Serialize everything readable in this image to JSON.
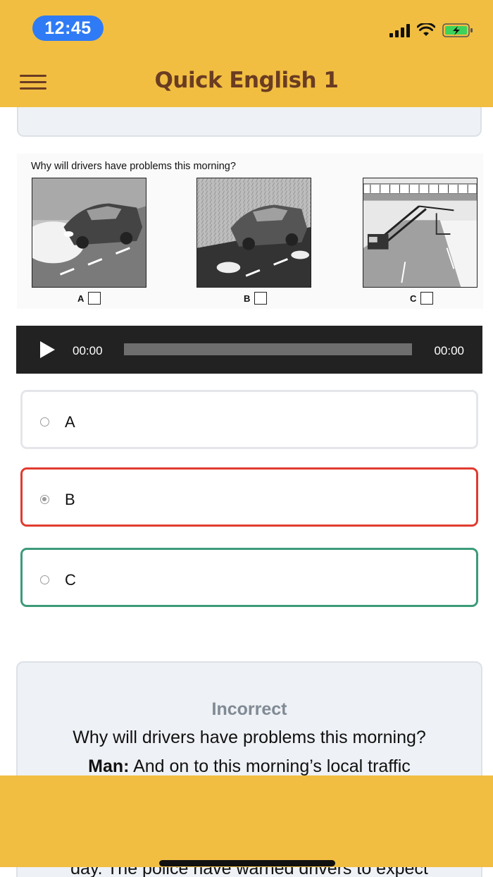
{
  "status_bar": {
    "time": "12:45"
  },
  "header": {
    "title": "Quick English 1"
  },
  "question": {
    "text": "Why will drivers have problems this morning?",
    "choices": [
      "A",
      "B",
      "C"
    ]
  },
  "player": {
    "current_time": "00:00",
    "duration": "00:00",
    "progress": 0
  },
  "options": [
    {
      "label": "A",
      "state": "default",
      "selected": false
    },
    {
      "label": "B",
      "state": "incorrect",
      "selected": true
    },
    {
      "label": "C",
      "state": "correct",
      "selected": false
    }
  ],
  "feedback": {
    "status": "Incorrect",
    "question": "Why will drivers have problems this morning?",
    "speaker": "Man:",
    "transcript": "And on to this morning’s local traffic",
    "extra_text": "day. The police have warned drivers to expect"
  },
  "colors": {
    "header_bg": "#f1be42",
    "title_color": "#6a3c22",
    "time_pill": "#2f7bf5",
    "battery": "#3dd35a",
    "incorrect_border": "#e03b30",
    "correct_border": "#3c9b78",
    "status_text": "#808a94"
  }
}
